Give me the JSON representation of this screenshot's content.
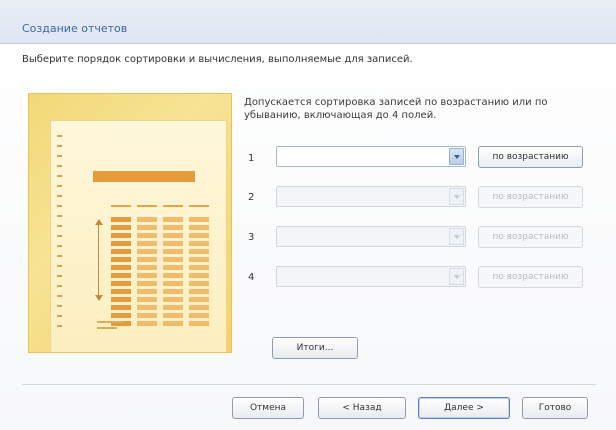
{
  "window": {
    "title": "Создание отчетов"
  },
  "instruction": "Выберите порядок сортировки и вычисления, выполняемые для записей.",
  "note": "Допускается сортировка записей по возрастанию или по убыванию, включающая до 4 полей.",
  "sort_rows": [
    {
      "number": "1",
      "value": "",
      "enabled": true,
      "order_label": "по возрастанию"
    },
    {
      "number": "2",
      "value": "",
      "enabled": false,
      "order_label": "по возрастанию"
    },
    {
      "number": "3",
      "value": "",
      "enabled": false,
      "order_label": "по возрастанию"
    },
    {
      "number": "4",
      "value": "",
      "enabled": false,
      "order_label": "по возрастанию"
    }
  ],
  "totals_button": "Итоги...",
  "footer": {
    "cancel": "Отмена",
    "back": "< Назад",
    "next": "Далее >",
    "finish": "Готово"
  },
  "colors": {
    "title": "#3a67a8",
    "preview_background": "#f4d97a",
    "preview_band": "#e79a3a"
  },
  "icons": {
    "dropdown": "chevron-down-icon"
  }
}
